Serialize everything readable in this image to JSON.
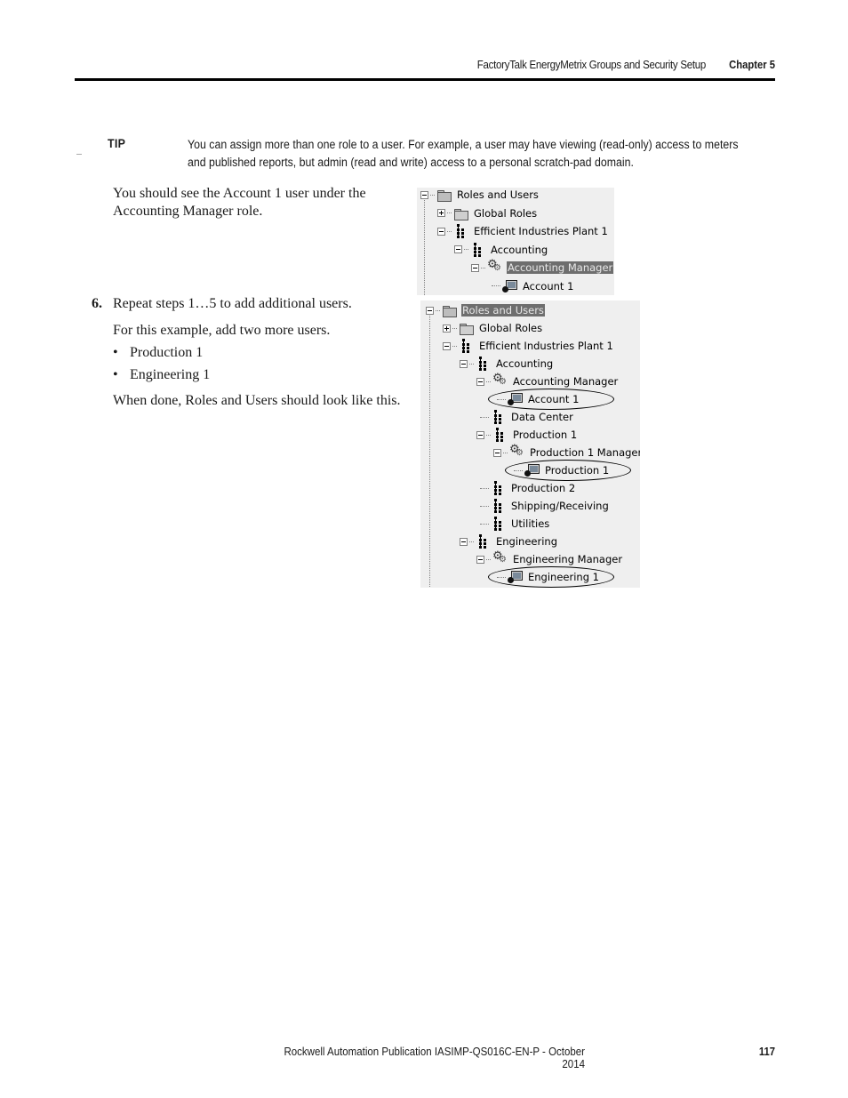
{
  "header": {
    "section_title": "FactoryTalk EnergyMetrix Groups and Security Setup",
    "chapter": "Chapter 5"
  },
  "tip": {
    "label": "TIP",
    "text": "You can assign more than one role to a user. For example, a user may have viewing (read-only) access to meters and published reports, but admin (read and write) access to a personal scratch-pad domain."
  },
  "body": {
    "intro": "You should see the Account 1 user under the Accounting Manager role.",
    "step": {
      "number": "6.",
      "text": "Repeat steps 1…5 to add additional users."
    },
    "example": "For this example, add two more users.",
    "bullets": [
      "Production 1",
      "Engineering 1"
    ],
    "bullet_glyph": "•",
    "closing": "When done, Roles and Users should look like this."
  },
  "tree1": {
    "nodes": [
      {
        "label": "Roles and Users",
        "icon": "folder-open-icon",
        "expander": "collapse",
        "level": 0
      },
      {
        "label": "Global Roles",
        "icon": "folder-icon",
        "expander": "expand",
        "level": 1
      },
      {
        "label": "Efficient Industries Plant 1",
        "icon": "hierarchy-group-icon",
        "expander": "collapse",
        "level": 1
      },
      {
        "label": "Accounting",
        "icon": "hierarchy-group-icon",
        "expander": "collapse",
        "level": 2
      },
      {
        "label": "Accounting Manager",
        "icon": "role-gears-icon",
        "expander": "collapse",
        "level": 3,
        "selected": true
      },
      {
        "label": "Account 1",
        "icon": "user-icon",
        "expander": "none",
        "level": 4
      }
    ]
  },
  "tree2": {
    "nodes": [
      {
        "label": "Roles and Users",
        "icon": "folder-open-icon",
        "expander": "collapse",
        "level": 0,
        "selected": true
      },
      {
        "label": "Global Roles",
        "icon": "folder-icon",
        "expander": "expand",
        "level": 1
      },
      {
        "label": "Efficient Industries Plant 1",
        "icon": "hierarchy-group-icon",
        "expander": "collapse",
        "level": 1
      },
      {
        "label": "Accounting",
        "icon": "hierarchy-group-icon",
        "expander": "collapse",
        "level": 2
      },
      {
        "label": "Accounting Manager",
        "icon": "role-gears-icon",
        "expander": "collapse",
        "level": 3
      },
      {
        "label": "Account 1",
        "icon": "user-icon",
        "expander": "none",
        "level": 4,
        "circled": true
      },
      {
        "label": "Data Center",
        "icon": "hierarchy-group-icon",
        "expander": "none",
        "level": 3
      },
      {
        "label": "Production 1",
        "icon": "hierarchy-group-icon",
        "expander": "collapse",
        "level": 3
      },
      {
        "label": "Production 1 Manager",
        "icon": "role-gears-icon",
        "expander": "collapse",
        "level": 4
      },
      {
        "label": "Production 1",
        "icon": "user-icon",
        "expander": "none",
        "level": 5,
        "circled": true
      },
      {
        "label": "Production 2",
        "icon": "hierarchy-group-icon",
        "expander": "none",
        "level": 3
      },
      {
        "label": "Shipping/Receiving",
        "icon": "hierarchy-group-icon",
        "expander": "none",
        "level": 3
      },
      {
        "label": "Utilities",
        "icon": "hierarchy-group-icon",
        "expander": "none",
        "level": 3
      },
      {
        "label": "Engineering",
        "icon": "hierarchy-group-icon",
        "expander": "collapse",
        "level": 2
      },
      {
        "label": "Engineering Manager",
        "icon": "role-gears-icon",
        "expander": "collapse",
        "level": 3
      },
      {
        "label": "Engineering 1",
        "icon": "user-icon",
        "expander": "none",
        "level": 4,
        "circled": true
      }
    ]
  },
  "footer": {
    "publication": "Rockwell Automation Publication IASIMP-QS016C-EN-P - October 2014",
    "page_number": "117"
  }
}
